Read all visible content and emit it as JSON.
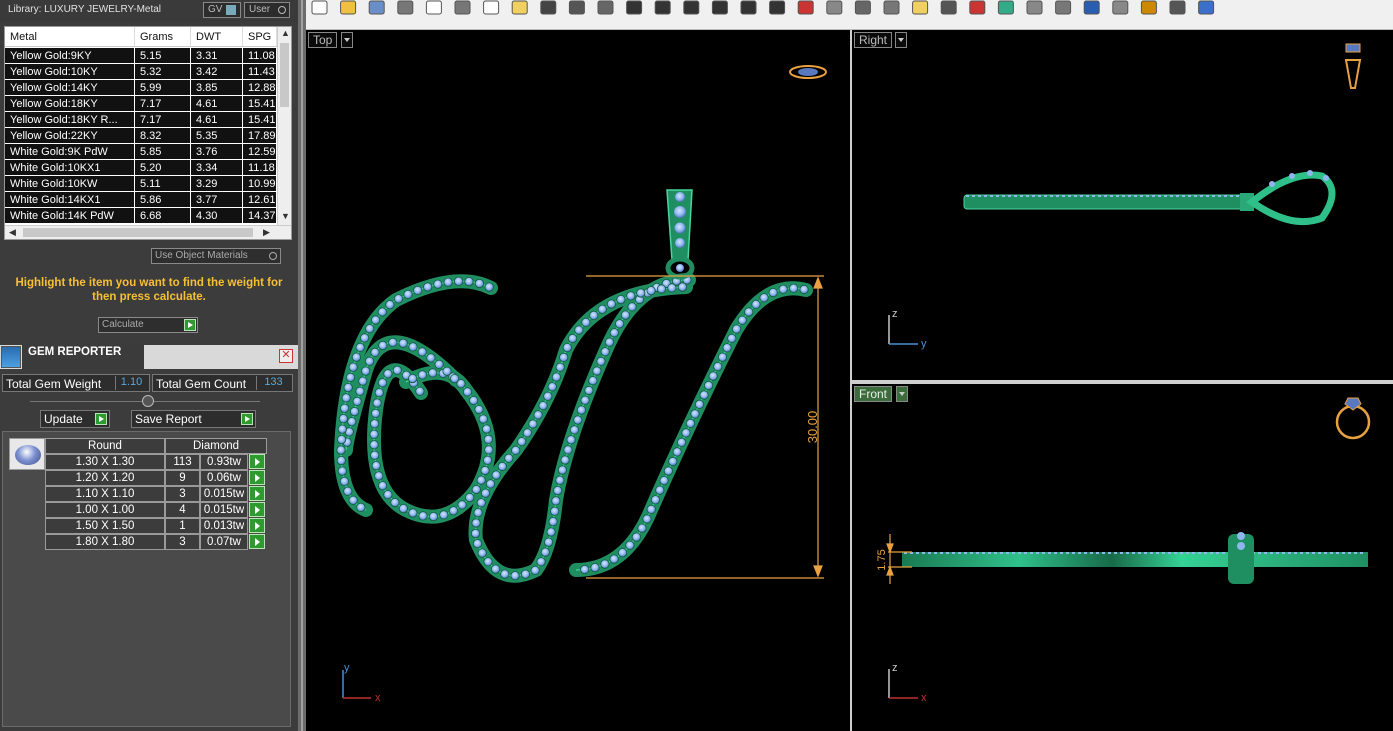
{
  "library": {
    "title": "Library: LUXURY JEWELRY-Metal",
    "gv_label": "GV",
    "user_label": "User"
  },
  "metal_table": {
    "columns": [
      "Metal",
      "Grams",
      "DWT",
      "SPG"
    ],
    "rows": [
      [
        "Yellow Gold:9KY",
        "5.15",
        "3.31",
        "11.08"
      ],
      [
        "Yellow Gold:10KY",
        "5.32",
        "3.42",
        "11.43"
      ],
      [
        "Yellow Gold:14KY",
        "5.99",
        "3.85",
        "12.88"
      ],
      [
        "Yellow Gold:18KY",
        "7.17",
        "4.61",
        "15.41"
      ],
      [
        "Yellow Gold:18KY R...",
        "7.17",
        "4.61",
        "15.41"
      ],
      [
        "Yellow Gold:22KY",
        "8.32",
        "5.35",
        "17.89"
      ],
      [
        "White Gold:9K PdW",
        "5.85",
        "3.76",
        "12.59"
      ],
      [
        "White Gold:10KX1",
        "5.20",
        "3.34",
        "11.18"
      ],
      [
        "White Gold:10KW",
        "5.11",
        "3.29",
        "10.99"
      ],
      [
        "White Gold:14KX1",
        "5.86",
        "3.77",
        "12.61"
      ],
      [
        "White Gold:14K PdW",
        "6.68",
        "4.30",
        "14.37"
      ]
    ]
  },
  "use_object_materials": "Use Object Materials",
  "instructions": "Highlight the item you want to find the weight for then press calculate.",
  "calculate_label": "Calculate",
  "gem_reporter": {
    "title": "GEM REPORTER",
    "total_weight_label": "Total Gem Weight",
    "total_weight": "1.10",
    "total_count_label": "Total Gem Count",
    "total_count": "133",
    "update_label": "Update",
    "save_label": "Save Report",
    "header_shape": "Round",
    "header_material": "Diamond",
    "rows": [
      {
        "size": "1.30 X 1.30",
        "count": "113",
        "tw": "0.93tw"
      },
      {
        "size": "1.20 X 1.20",
        "count": "9",
        "tw": "0.06tw"
      },
      {
        "size": "1.10 X 1.10",
        "count": "3",
        "tw": "0.015tw"
      },
      {
        "size": "1.00 X 1.00",
        "count": "4",
        "tw": "0.015tw"
      },
      {
        "size": "1.50 X 1.50",
        "count": "1",
        "tw": "0.013tw"
      },
      {
        "size": "1.80 X 1.80",
        "count": "3",
        "tw": "0.07tw"
      }
    ]
  },
  "viewports": {
    "top_label": "Top",
    "right_label": "Right",
    "front_label": "Front",
    "dimension_top": "30.00",
    "dimension_front": "1.75",
    "axis_top": [
      "y",
      "x"
    ],
    "axis_right": [
      "z",
      "y"
    ],
    "axis_front": [
      "z",
      "x"
    ]
  },
  "colors": {
    "metal_green": "#1f8f62",
    "gem_blue": "#8fb6f0",
    "dimension_orange": "#e8a040"
  },
  "toolbar_icons": [
    "new-icon",
    "open-icon",
    "save-icon",
    "print-icon",
    "page-icon",
    "cut-icon",
    "copy-icon",
    "paste-icon",
    "undo-icon",
    "pan-icon",
    "move-icon",
    "zoom-in-icon",
    "zoom-window-icon",
    "zoom-out-icon",
    "zoom-extents-icon",
    "zoom-selected-icon",
    "grid-icon",
    "car-icon",
    "snap-icon",
    "rotate-icon",
    "points-icon",
    "light-icon",
    "layer-icon",
    "material-icon",
    "color-icon",
    "sphere-icon",
    "render-icon",
    "globe-icon",
    "magic-icon",
    "settings-icon",
    "tree-icon",
    "help-icon"
  ]
}
